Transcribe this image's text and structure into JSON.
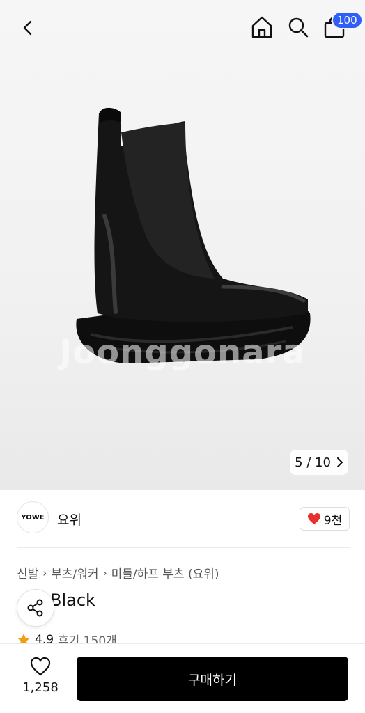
{
  "header": {
    "cart_badge": "100"
  },
  "gallery": {
    "watermark": "Joonggonara",
    "counter": "5 / 10"
  },
  "store": {
    "logo_text": "YOWE",
    "name": "요위",
    "like_count": "9천"
  },
  "breadcrumb": [
    "신발",
    "부츠/워커",
    "미들/하프 부츠 (요위)"
  ],
  "product": {
    "title": "Black",
    "rating": "4.9",
    "review_text": "후기 150개"
  },
  "bottom": {
    "wish_count": "1,258",
    "buy_label": "구매하기"
  },
  "colors": {
    "badge": "#2f5ff7",
    "heart": "#e5322d",
    "star": "#f39c12",
    "buy_button": "#000000"
  }
}
